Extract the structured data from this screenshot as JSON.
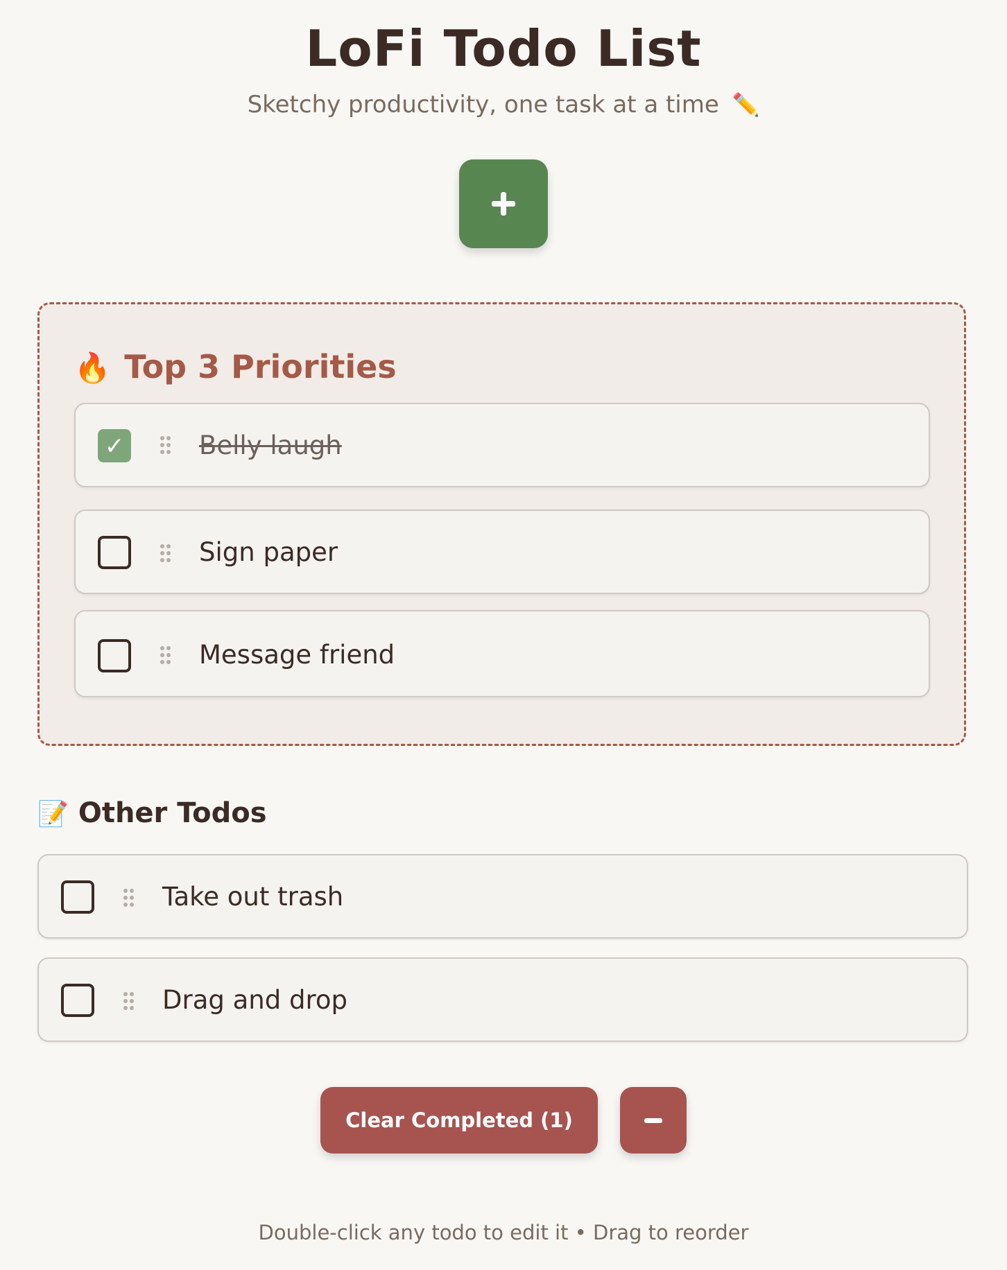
{
  "header": {
    "title": "LoFi Todo List",
    "subtitle": "Sketchy productivity, one task at a time",
    "subtitle_icon": "✏️"
  },
  "add_button": {
    "icon": "plus-icon",
    "color": "#588650"
  },
  "priorities": {
    "icon": "🔥",
    "title": "Top 3 Priorities",
    "border_color": "#a45a47",
    "items": [
      {
        "text": "Belly laugh",
        "completed": true,
        "check_mark": "✓"
      },
      {
        "text": "Sign paper",
        "completed": false
      },
      {
        "text": "Message friend",
        "completed": false
      }
    ]
  },
  "other": {
    "icon": "📝",
    "title": "Other Todos",
    "items": [
      {
        "text": "Take out trash",
        "completed": false
      },
      {
        "text": "Drag and drop",
        "completed": false
      }
    ]
  },
  "actions": {
    "clear_label": "Clear Completed (1)",
    "minus_icon": "minus-icon",
    "accent": "#a75450"
  },
  "footer": {
    "hint": "Double-click any todo to edit it • Drag to reorder"
  }
}
